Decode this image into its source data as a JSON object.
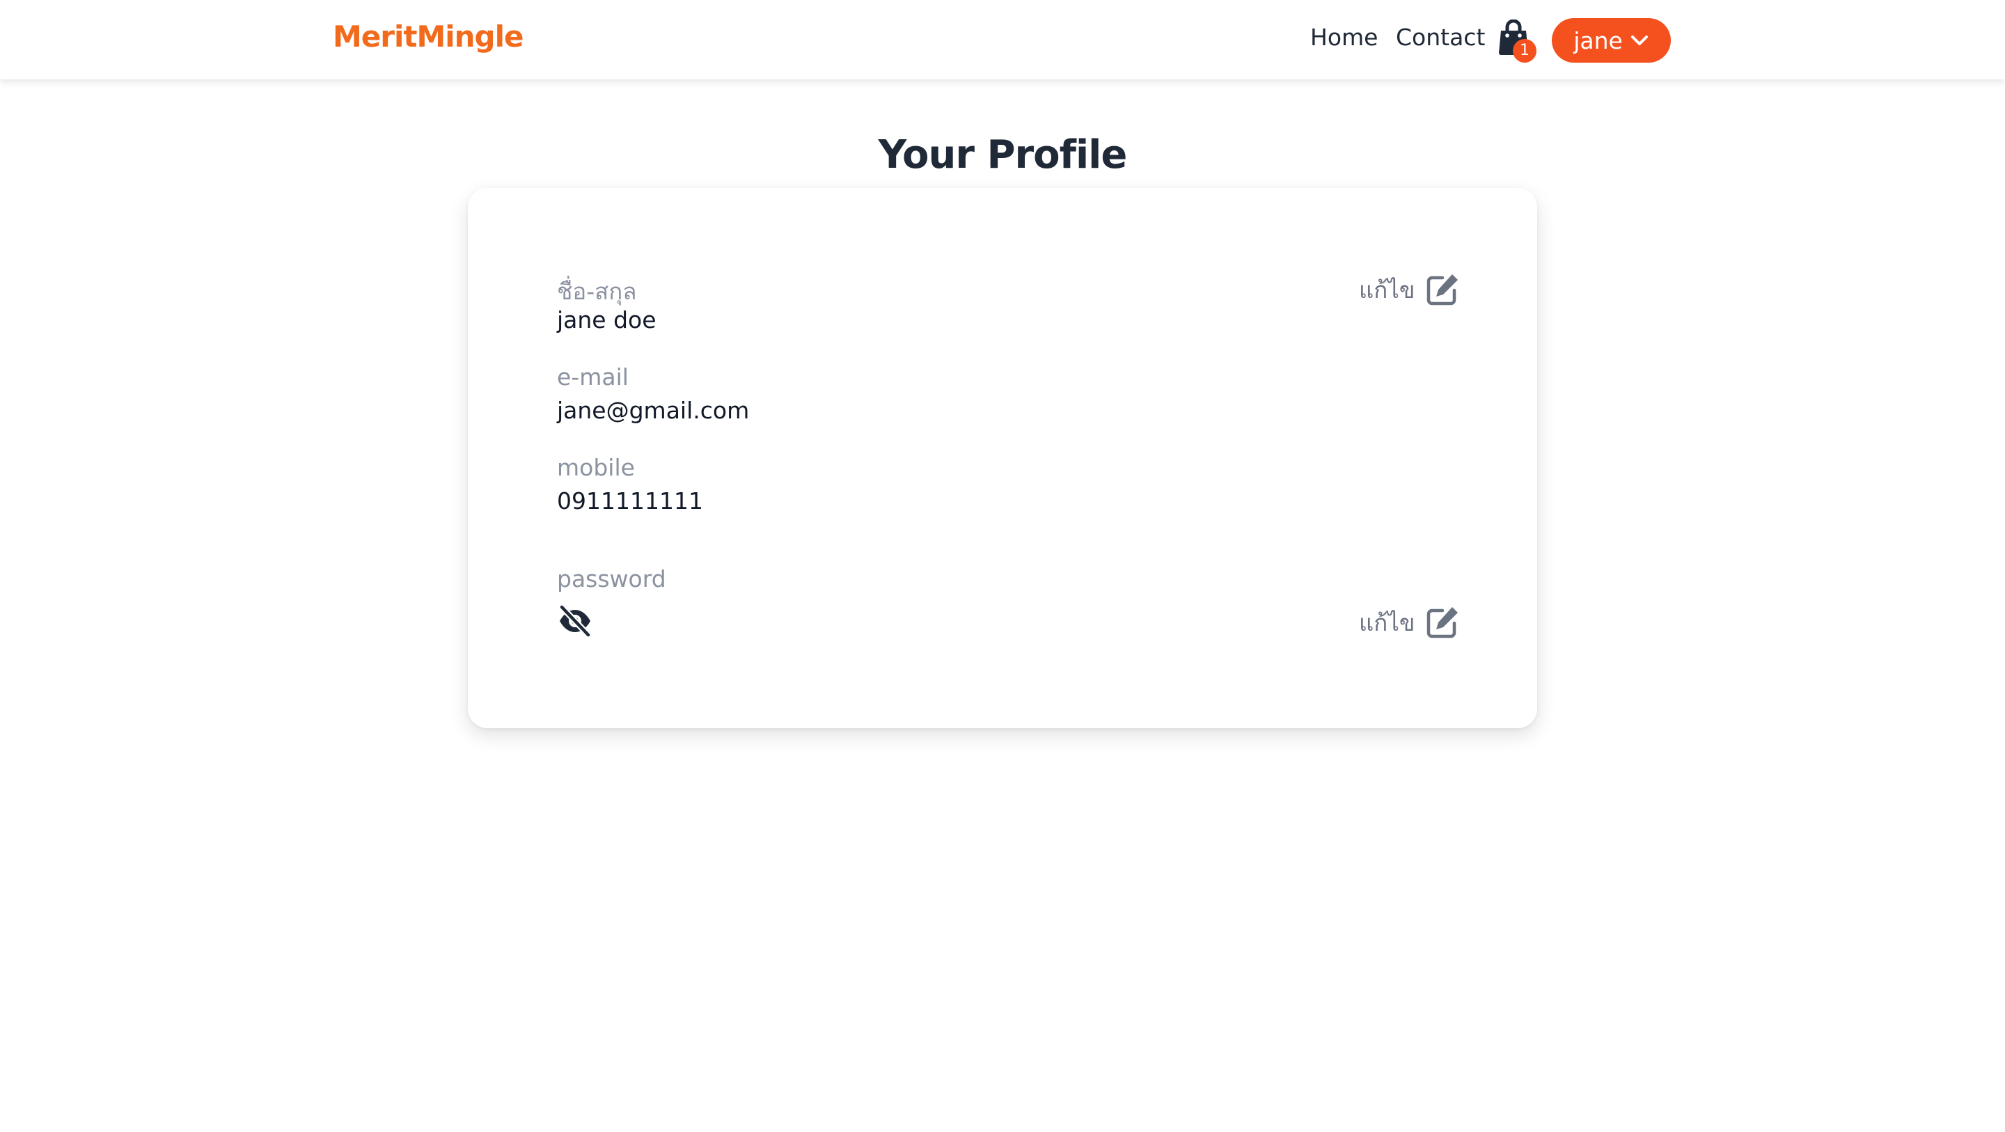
{
  "navbar": {
    "logo": "MeritMingle",
    "links": [
      {
        "label": "Home"
      },
      {
        "label": "Contact"
      }
    ],
    "cart": {
      "icon": "shopping-bag-icon",
      "count": "1"
    },
    "user_menu": {
      "label": "jane",
      "icon": "chevron-down-icon"
    }
  },
  "page": {
    "title": "Your Profile"
  },
  "profile": {
    "name": {
      "label": "ชื่อ-สกุล",
      "value": "jane doe"
    },
    "email": {
      "label": "e-mail",
      "value": "jane@gmail.com"
    },
    "mobile": {
      "label": "mobile",
      "value": "0911111111"
    },
    "password": {
      "label": "password",
      "icon": "eye-off-icon"
    },
    "edit_label": "แก้ไข",
    "edit_icon": "edit-icon"
  },
  "colors": {
    "brand": "#f26b1d",
    "accent": "#f4511e",
    "label": "#8b92a0",
    "text": "#111827"
  }
}
